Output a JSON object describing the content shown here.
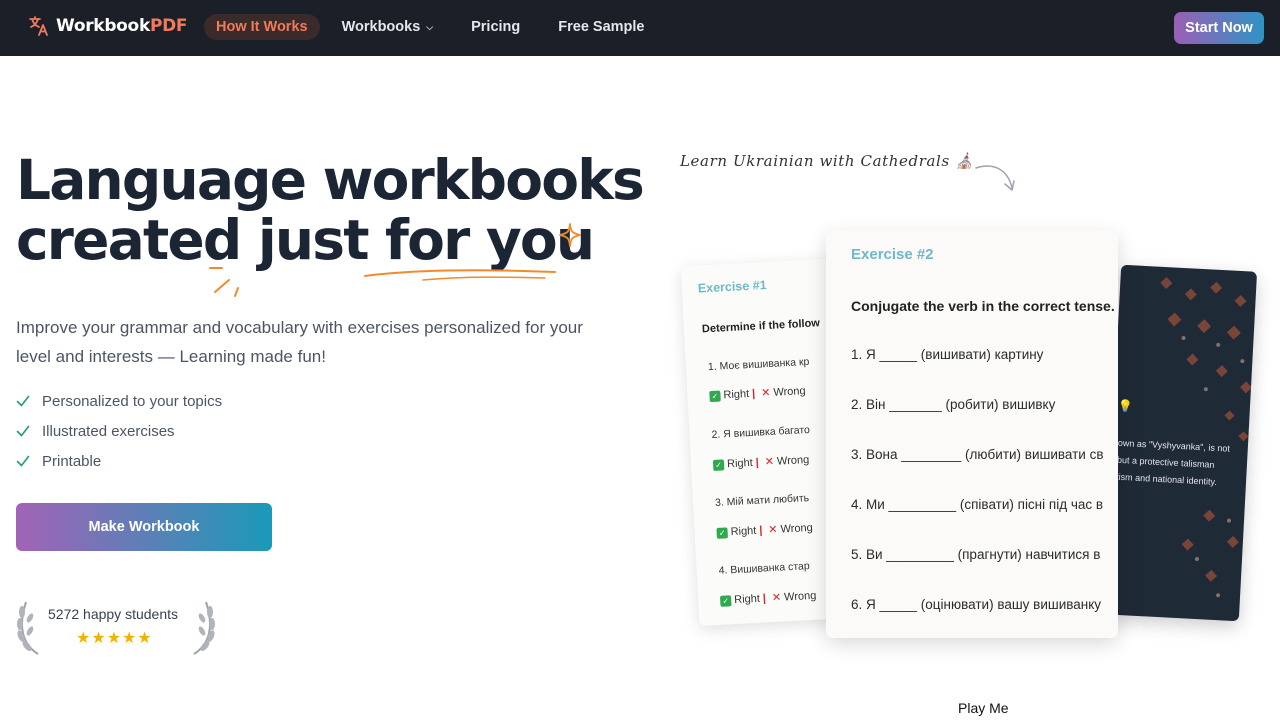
{
  "nav": {
    "logo_main": "Workbook",
    "logo_accent": "PDF",
    "links": [
      {
        "label": "How It Works"
      },
      {
        "label": "Workbooks"
      },
      {
        "label": "Pricing"
      },
      {
        "label": "Free Sample"
      }
    ],
    "start_label": "Start Now"
  },
  "hero": {
    "headline_line1": "Language workbooks",
    "headline_line2": "created just for you",
    "subtext": "Improve your grammar and vocabulary with exercises personalized for your level and interests — Learning made fun!",
    "features": [
      "Personalized to your topics",
      "Illustrated exercises",
      "Printable"
    ],
    "cta_label": "Make Workbook",
    "students_text": "5272 happy students",
    "stars": "★★★★★",
    "rating": 5
  },
  "preview": {
    "handnote": "Learn Ukrainian with Cathedrals ⛪",
    "card1": {
      "title": "Exercise #1",
      "prompt": "Determine if the follow",
      "questions": [
        "1.  Моє вишиванка кр",
        "2.  Я вишивка багато",
        "3.  Мій мати любить",
        "4.  Вишиванка стар"
      ],
      "right": "Right",
      "sep": "|",
      "wrong": "Wrong"
    },
    "card2": {
      "title": "Exercise #2",
      "prompt": "Conjugate the verb in the correct tense.",
      "questions": [
        "1.   Я _____ (вишивати) картину",
        "2.   Він _______ (робити) вишивку",
        "3.   Вона ________ (любити) вишивати св",
        "4.   Ми _________ (співати) пісні під час в",
        "5.   Ви _________ (прагнути) навчитися в",
        "6.   Я _____ (оцінювати) вашу вишиванку"
      ]
    },
    "card3": {
      "caption_lines": [
        "own as \"Vyshyvanka\", is not",
        "but a protective talisman",
        "tism and national identity."
      ]
    },
    "play_label": "Play Me"
  }
}
